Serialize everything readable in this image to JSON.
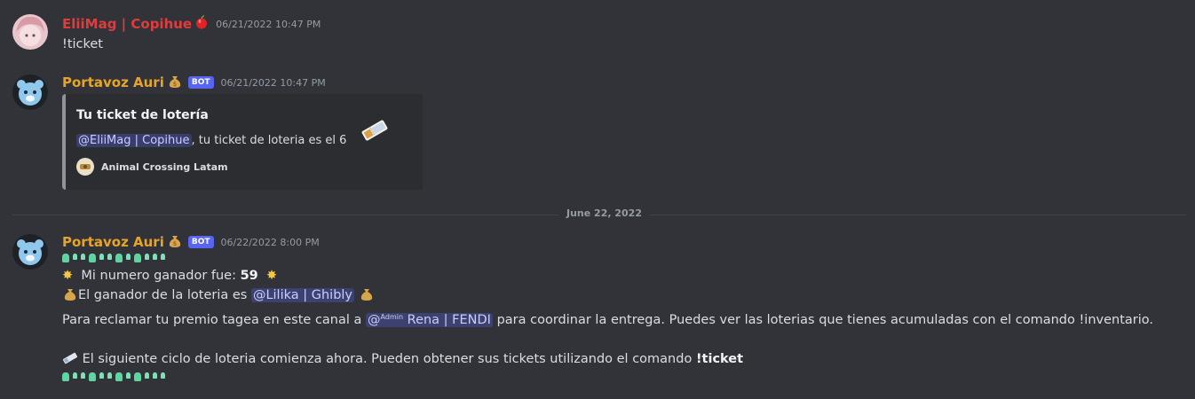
{
  "messages": [
    {
      "author": "EliiMag | Copihue",
      "author_emoji": "apple-icon",
      "timestamp": "06/21/2022 10:47 PM",
      "text": "!ticket"
    },
    {
      "author": "Portavoz Auri",
      "author_emoji": "money-bag-icon",
      "bot_tag": "BOT",
      "timestamp": "06/21/2022 10:47 PM",
      "embed": {
        "title": "Tu ticket de lotería",
        "mention": "@EliiMag | Copihue",
        "desc_rest": ", tu ticket de loteria es el 6",
        "footer": "Animal Crossing Latam"
      }
    },
    {
      "author": "Portavoz Auri",
      "author_emoji": "money-bag-icon",
      "bot_tag": "BOT",
      "timestamp": "06/22/2022 8:00 PM",
      "line2_text": "Mi numero ganador fue: ",
      "line2_number": "59",
      "line3_text": "El ganador de la loteria es ",
      "line3_mention": "@Lilika | Ghibly",
      "line4_text_a": " Para reclamar tu premio tagea en este canal a ",
      "line4_mention_prefix": "@",
      "line4_mention_sup": "Admin",
      "line4_mention_name": " Rena | FENDI",
      "line4_text_b": " para coordinar la entrega. Puedes ver las loterias que tienes acumuladas con el comando !inventario.",
      "line5_text": " El siguiente ciclo de loteria comienza ahora. Pueden obtener sus tickets utilizando el comando ",
      "line5_bold": "!ticket"
    }
  ],
  "divider": "June 22, 2022",
  "colors": {
    "background": "#313338",
    "accent": "#5865f2",
    "red_name": "#e03c3c",
    "gold_name": "#e6a52a"
  }
}
